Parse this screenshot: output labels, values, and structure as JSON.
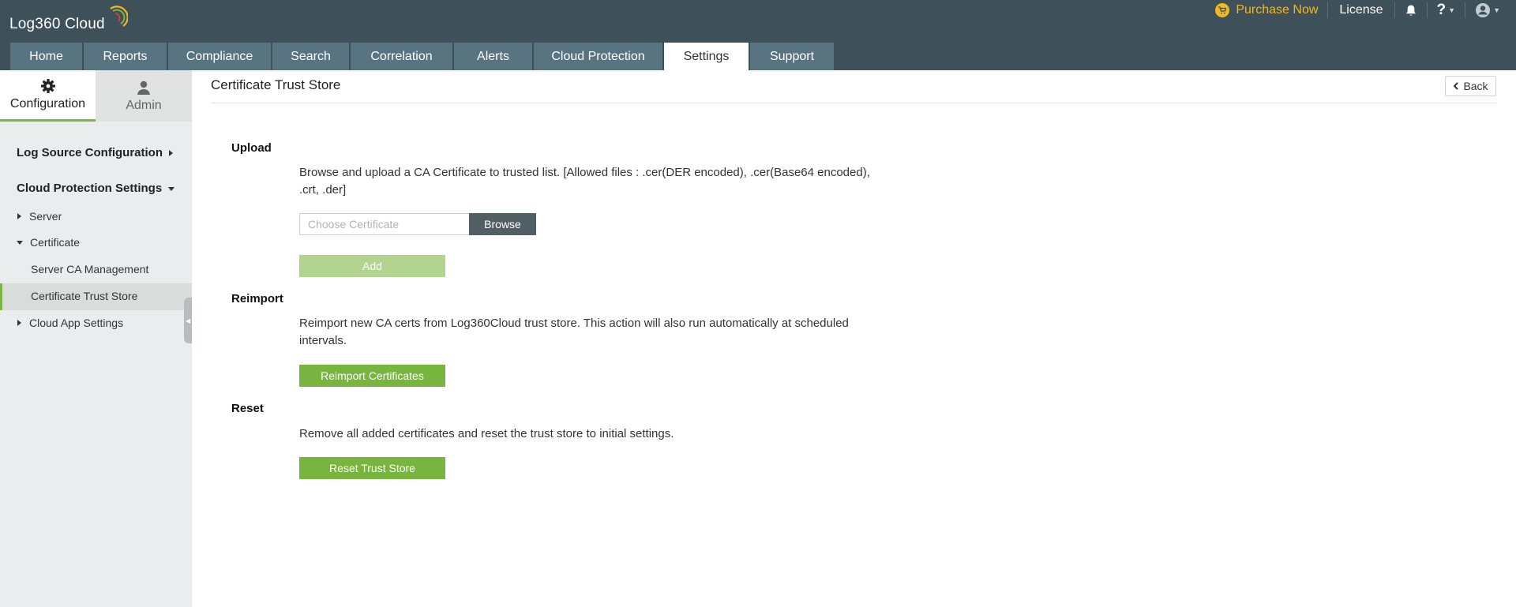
{
  "brand": {
    "logo_text": "Log360  Cloud"
  },
  "header": {
    "purchase_label": "Purchase Now",
    "license_label": "License",
    "help_label": "?"
  },
  "nav": {
    "tabs": [
      {
        "label": "Home"
      },
      {
        "label": "Reports"
      },
      {
        "label": "Compliance"
      },
      {
        "label": "Search"
      },
      {
        "label": "Correlation"
      },
      {
        "label": "Alerts"
      },
      {
        "label": "Cloud Protection"
      },
      {
        "label": "Settings",
        "active": true
      },
      {
        "label": "Support"
      }
    ]
  },
  "sidebar": {
    "tabs": {
      "configuration": "Configuration",
      "admin": "Admin"
    },
    "sections": {
      "log_source": "Log Source Configuration",
      "cloud_protection": "Cloud Protection Settings"
    },
    "items": {
      "server": "Server",
      "certificate": "Certificate",
      "server_ca": "Server CA Management",
      "trust_store": "Certificate Trust Store",
      "cloud_app": "Cloud App Settings"
    },
    "active_item": "Certificate Trust Store"
  },
  "page": {
    "title": "Certificate Trust Store",
    "back_label": "Back"
  },
  "upload": {
    "heading": "Upload",
    "description": "Browse and upload a CA Certificate to trusted list. [Allowed files : .cer(DER encoded), .cer(Base64 encoded), .crt, .der]",
    "placeholder": "Choose Certificate",
    "browse_label": "Browse",
    "add_label": "Add"
  },
  "reimport": {
    "heading": "Reimport",
    "description": "Reimport new CA certs from Log360Cloud trust store. This action will also run automatically at scheduled intervals.",
    "button_label": "Reimport Certificates"
  },
  "reset": {
    "heading": "Reset",
    "description": "Remove all added certificates and reset the trust store to initial settings.",
    "button_label": "Reset Trust Store"
  },
  "colors": {
    "header_bg": "#3e5059",
    "tab_bg": "#587480",
    "accent_green": "#78b53e",
    "purchase_yellow": "#f5b81c"
  }
}
